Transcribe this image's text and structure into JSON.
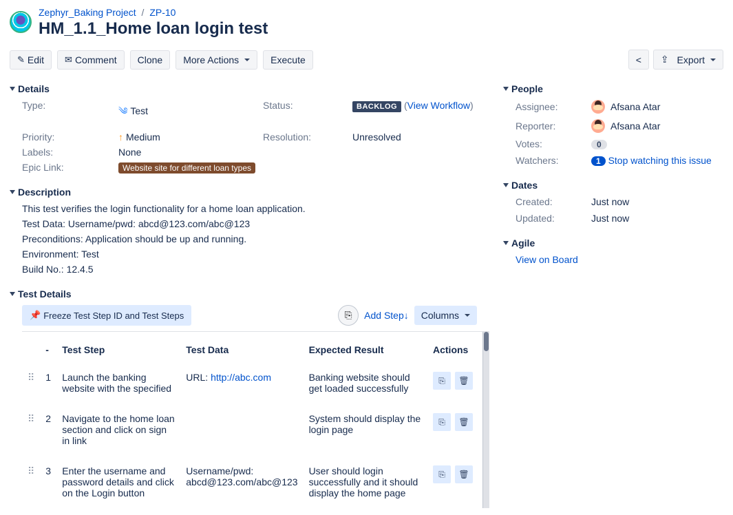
{
  "breadcrumb": {
    "project": "Zephyr_Baking Project",
    "issue_key": "ZP-10"
  },
  "title": "HM_1.1_Home loan login test",
  "toolbar": {
    "edit": "Edit",
    "comment": "Comment",
    "clone": "Clone",
    "more": "More Actions",
    "execute": "Execute",
    "export": "Export"
  },
  "sections": {
    "details": "Details",
    "description": "Description",
    "test_details": "Test Details",
    "people": "People",
    "dates": "Dates",
    "agile": "Agile"
  },
  "details": {
    "labels": {
      "type": "Type:",
      "priority": "Priority:",
      "labels": "Labels:",
      "epic": "Epic Link:",
      "status": "Status:",
      "resolution": "Resolution:"
    },
    "type": "Test",
    "priority": "Medium",
    "labels_val": "None",
    "epic": "Website site for different loan types",
    "status": "BACKLOG",
    "view_workflow": "View Workflow",
    "resolution": "Unresolved"
  },
  "description": {
    "p1": "This test verifies the login functionality for a home loan application.",
    "p2": "Test Data: Username/pwd: abcd@123.com/abc@123",
    "p3": "Preconditions: Application should be up and running.",
    "p4": "Environment: Test",
    "p5": "Build No.: 12.4.5"
  },
  "test_details": {
    "freeze": "Freeze Test Step ID and Test Steps",
    "add_step": "Add Step",
    "columns": "Columns",
    "headers": {
      "dash": "-",
      "step": "Test Step",
      "data": "Test Data",
      "expected": "Expected Result",
      "actions": "Actions"
    },
    "rows": [
      {
        "n": "1",
        "drag": "⠿",
        "step": "Launch the banking website with the specified",
        "data_prefix": "URL: ",
        "data_link": "http://abc.com",
        "expected": "Banking website should get loaded successfully"
      },
      {
        "n": "2",
        "drag": "⠿",
        "step": "Navigate to the home loan section and click on sign in link",
        "data_prefix": "",
        "data_link": "",
        "expected": "System should display the login page"
      },
      {
        "n": "3",
        "drag": "⠿",
        "step": "Enter the username and password details and click on the Login button",
        "data_prefix": "Username/pwd: abcd@123.com/abc@123",
        "data_link": "",
        "expected": "User should login successfully and it should display the home page"
      }
    ]
  },
  "people": {
    "labels": {
      "assignee": "Assignee:",
      "reporter": "Reporter:",
      "votes": "Votes:",
      "watchers": "Watchers:"
    },
    "assignee": "Afsana Atar",
    "reporter": "Afsana Atar",
    "votes": "0",
    "watchers_count": "1",
    "stop_watching": "Stop watching this issue"
  },
  "dates": {
    "labels": {
      "created": "Created:",
      "updated": "Updated:"
    },
    "created": "Just now",
    "updated": "Just now"
  },
  "agile": {
    "view_on_board": "View on Board"
  },
  "icons": {
    "pencil": "✎",
    "comment": "💬",
    "pin": "📌",
    "copy": "❐",
    "trash": "🗑",
    "clone": "⎘",
    "share": "⋔",
    "export": "⬆"
  }
}
